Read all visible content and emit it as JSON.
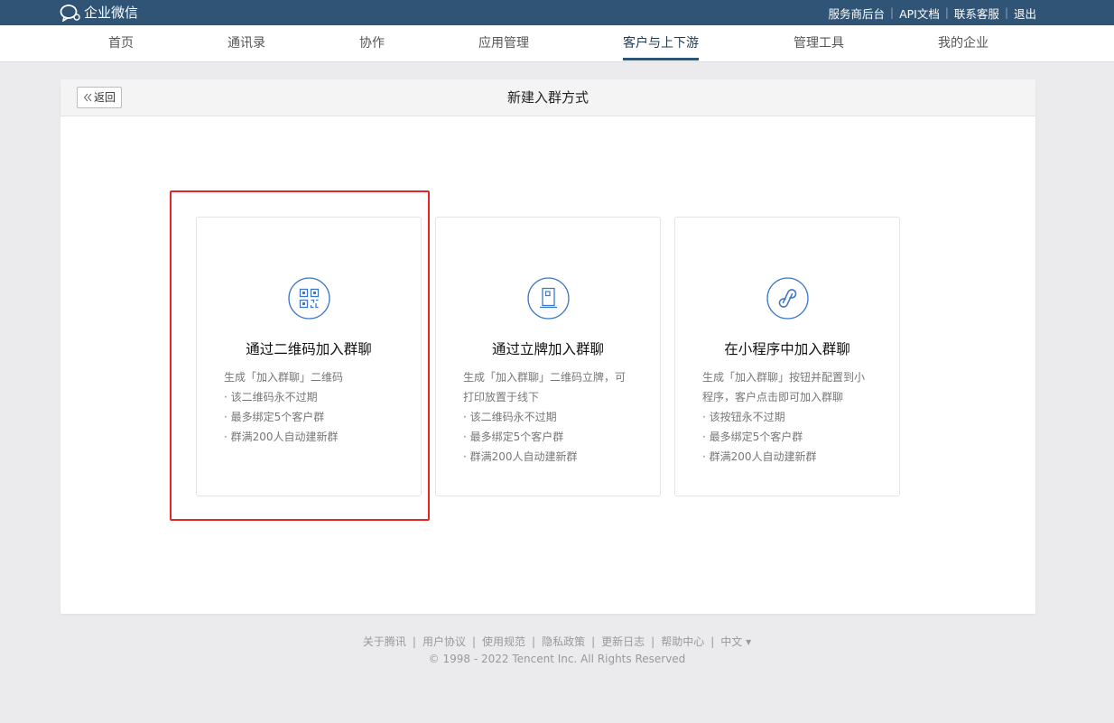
{
  "app": {
    "logo_text": "企业微信"
  },
  "top_links": [
    "服务商后台",
    "API文档",
    "联系客服",
    "退出"
  ],
  "nav": {
    "items": [
      "首页",
      "通讯录",
      "协作",
      "应用管理",
      "客户与上下游",
      "管理工具",
      "我的企业"
    ],
    "active": "客户与上下游"
  },
  "panel": {
    "back_label": "返回",
    "title": "新建入群方式"
  },
  "cards": [
    {
      "icon": "qr-code-icon",
      "title": "通过二维码加入群聊",
      "lines": [
        "生成「加入群聊」二维码",
        "· 该二维码永不过期",
        "· 最多绑定5个客户群",
        "· 群满200人自动建新群"
      ],
      "highlighted": true
    },
    {
      "icon": "standee-icon",
      "title": "通过立牌加入群聊",
      "lines": [
        "生成「加入群聊」二维码立牌，可",
        "打印放置于线下",
        "· 该二维码永不过期",
        "· 最多绑定5个客户群",
        "· 群满200人自动建新群"
      ],
      "highlighted": false
    },
    {
      "icon": "mini-program-icon",
      "title": "在小程序中加入群聊",
      "lines": [
        "生成「加入群聊」按钮并配置到小",
        "程序，客户点击即可加入群聊",
        "· 该按钮永不过期",
        "· 最多绑定5个客户群",
        "· 群满200人自动建新群"
      ],
      "highlighted": false
    }
  ],
  "footer": {
    "links": [
      "关于腾讯",
      "用户协议",
      "使用规范",
      "隐私政策",
      "更新日志",
      "帮助中心",
      "中文 ▾"
    ],
    "copyright": "© 1998 - 2022 Tencent Inc. All Rights Reserved"
  },
  "colors": {
    "topbar": "#2f5476",
    "accent_icon": "#3f78c8",
    "highlight_box": "#e0282b",
    "page_bg": "#ebebed"
  }
}
